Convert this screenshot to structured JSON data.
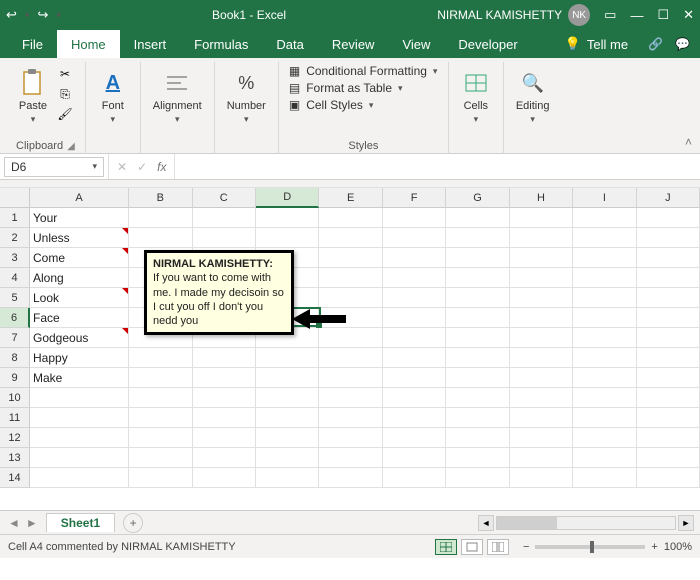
{
  "title_bar": {
    "doc_title": "Book1 - Excel",
    "user_name": "NIRMAL KAMISHETTY",
    "user_initials": "NK"
  },
  "tabs": {
    "file": "File",
    "home": "Home",
    "insert": "Insert",
    "formulas": "Formulas",
    "data": "Data",
    "review": "Review",
    "view": "View",
    "developer": "Developer",
    "tell_me": "Tell me"
  },
  "ribbon": {
    "clipboard": {
      "paste": "Paste",
      "label": "Clipboard"
    },
    "font": {
      "btn": "Font"
    },
    "alignment": {
      "btn": "Alignment"
    },
    "number": {
      "btn": "Number"
    },
    "styles": {
      "cond": "Conditional Formatting",
      "table": "Format as Table",
      "cell": "Cell Styles",
      "label": "Styles"
    },
    "cells": {
      "btn": "Cells"
    },
    "editing": {
      "btn": "Editing"
    }
  },
  "formula_bar": {
    "name_box": "D6",
    "fx": "fx"
  },
  "columns": [
    "A",
    "B",
    "C",
    "D",
    "E",
    "F",
    "G",
    "H",
    "I",
    "J"
  ],
  "rows_shown": 14,
  "cells": {
    "A1": "Your",
    "A2": "Unless",
    "A3": "Come",
    "A4": "Along",
    "A5": "Look",
    "A6": "Face",
    "A7": "Godgeous",
    "A8": "Happy",
    "A9": "Make"
  },
  "active_cell": {
    "col": "D",
    "row": 6
  },
  "comment_marks": [
    "A2",
    "A3",
    "A5",
    "A7"
  ],
  "comment_popup": {
    "author": "NIRMAL KAMISHETTY:",
    "body": "If you want to come with me. I made my decisoin so I cut you off I don't you nedd you"
  },
  "sheet_tabs": {
    "active": "Sheet1"
  },
  "status_bar": {
    "msg": "Cell A4 commented by NIRMAL KAMISHETTY",
    "zoom": "100%"
  }
}
